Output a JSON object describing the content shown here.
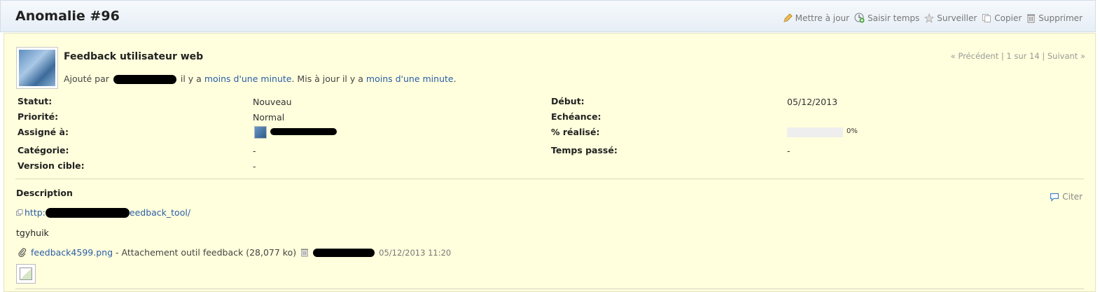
{
  "header": {
    "title": "Anomalie #96",
    "actions": {
      "update": "Mettre à jour",
      "log_time": "Saisir temps",
      "watch": "Surveiller",
      "copy": "Copier",
      "delete": "Supprimer"
    }
  },
  "issue": {
    "subject": "Feedback utilisateur web",
    "added_prefix": "Ajouté par",
    "added_mid": "il y a",
    "added_link": "moins d'une minute",
    "updated_mid": ". Mis à jour il y a",
    "updated_link": "moins d'une minute",
    "updated_end": ".",
    "nav": {
      "previous": "« Précédent",
      "sep1": "|",
      "position": "1 sur 14",
      "sep2": "|",
      "next": "Suivant »"
    },
    "attributes": {
      "status_label": "Statut:",
      "status_value": "Nouveau",
      "priority_label": "Priorité:",
      "priority_value": "Normal",
      "assigned_label": "Assigné à:",
      "category_label": "Catégorie:",
      "category_value": "-",
      "version_label": "Version cible:",
      "version_value": "-",
      "start_label": "Début:",
      "start_value": "05/12/2013",
      "due_label": "Echéance:",
      "done_label": "% réalisé:",
      "done_value": "0%",
      "done_fraction": 0,
      "spent_label": "Temps passé:",
      "spent_value": "-"
    },
    "description": {
      "title": "Description",
      "quote": "Citer",
      "url_start": "http:",
      "url_end": "eedback_tool/",
      "text": "tgyhuik"
    },
    "attachment": {
      "filename": "feedback4599.png",
      "description": "- Attachement outil feedback (28,077 ko)",
      "date": "05/12/2013 11:20"
    }
  }
}
